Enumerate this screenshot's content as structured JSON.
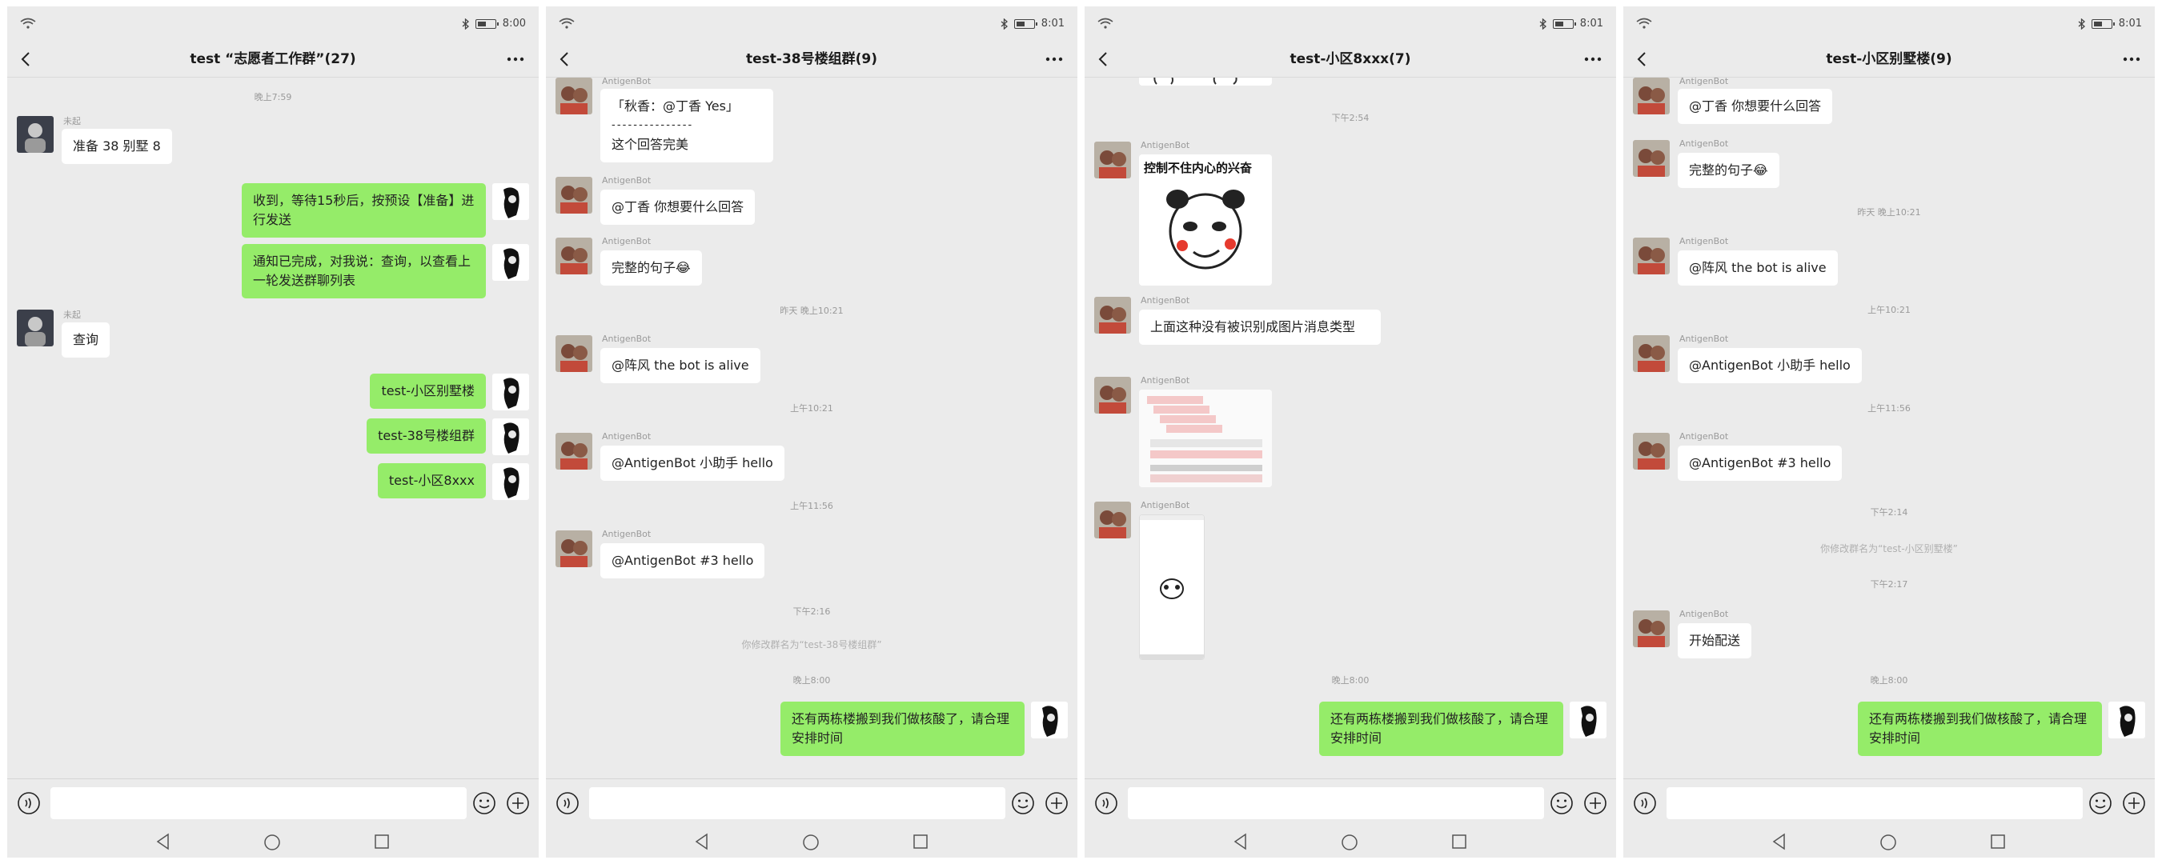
{
  "status": {
    "time_1": "8:00",
    "time_2": "8:01",
    "time_3": "8:01",
    "time_4": "8:01"
  },
  "screens": [
    {
      "title": "test “志愿者工作群”(27)",
      "time_top": "晚上7:59",
      "sender_1": "未起",
      "msg_1": "准备 38 别墅 8",
      "msg_2": "收到，等待15秒后，按预设【准备】进行发送",
      "msg_3": "通知已完成，对我说：查询，以查看上一轮发送群聊列表",
      "sender_2": "未起",
      "msg_4": "查询",
      "msg_5": "test-小区别墅楼",
      "msg_6": "test-38号楼组群",
      "msg_7": "test-小区8xxx"
    },
    {
      "title": "test-38号楼组群(9)",
      "sender_top": "AntigenBot",
      "quote_line_1": "「秋香：@丁香 Yes」",
      "quote_line_2": "- - - - - - - - - - - - - - -",
      "quote_line_3": "这个回答完美",
      "sender_1": "AntigenBot",
      "msg_1": "@丁香 你想要什么回答",
      "sender_2": "AntigenBot",
      "msg_2": "完整的句子😂",
      "time_1": "昨天 晚上10:21",
      "sender_3": "AntigenBot",
      "msg_3": "@阵风 the bot is alive",
      "time_2": "上午10:21",
      "sender_4": "AntigenBot",
      "msg_4": "@AntigenBot 小助手 hello",
      "time_3": "上午11:56",
      "sender_5": "AntigenBot",
      "msg_5": "@AntigenBot #3 hello",
      "time_4": "下午2:16",
      "sys_note": "你修改群名为“test-38号楼组群”",
      "time_5": "晚上8:00",
      "msg_6": "还有两栋楼搬到我们做核酸了，请合理安排时间"
    },
    {
      "title": "test-小区8xxx(7)",
      "time_1": "下午2:54",
      "sender_1": "AntigenBot",
      "sticker_text": "控制不住内心的兴奋",
      "sender_2": "AntigenBot",
      "msg_1": "上面这种没有被识别成图片消息类型",
      "sender_3": "AntigenBot",
      "sender_4": "AntigenBot",
      "time_2": "晚上8:00",
      "msg_2": "还有两栋楼搬到我们做核酸了，请合理安排时间"
    },
    {
      "title": "test-小区别墅楼(9)",
      "sender_top": "AntigenBot",
      "msg_top": "@丁香 你想要什么回答",
      "sender_1": "AntigenBot",
      "msg_1": "完整的句子😂",
      "time_1": "昨天 晚上10:21",
      "sender_2": "AntigenBot",
      "msg_2": "@阵风 the bot is alive",
      "time_2": "上午10:21",
      "sender_3": "AntigenBot",
      "msg_3": "@AntigenBot 小助手 hello",
      "time_3": "上午11:56",
      "sender_4": "AntigenBot",
      "msg_4": "@AntigenBot #3 hello",
      "time_4": "下午2:14",
      "sys_note": "你修改群名为“test-小区别墅楼”",
      "time_5": "下午2:17",
      "sender_5": "AntigenBot",
      "msg_5": "开始配送",
      "time_6": "晚上8:00",
      "msg_6": "还有两栋楼搬到我们做核酸了，请合理安排时间"
    }
  ],
  "colors": {
    "chat_bg": "#ebebeb",
    "out_bubble": "#95ec69",
    "in_bubble": "#ffffff"
  },
  "icons": [
    "wifi-icon",
    "bluetooth-icon",
    "battery-icon",
    "back-arrow-icon",
    "more-icon",
    "voice-icon",
    "emoji-icon",
    "plus-icon",
    "nav-back-icon",
    "nav-home-icon",
    "nav-recent-icon"
  ]
}
